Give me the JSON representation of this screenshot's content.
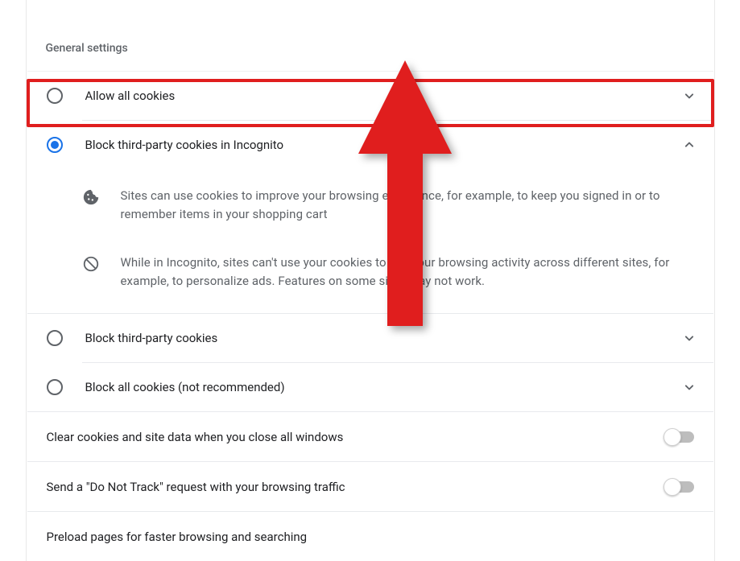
{
  "sectionTitle": "General settings",
  "options": {
    "allowAll": {
      "label": "Allow all cookies"
    },
    "blockIncognito": {
      "label": "Block third-party cookies in Incognito",
      "details": {
        "cookie": "Sites can use cookies to improve your browsing experience, for example, to keep you signed in or to remember items in your shopping cart",
        "block": "While in Incognito, sites can't use your cookies to see your browsing activity across different sites, for example, to personalize ads. Features on some sites may not work."
      }
    },
    "blockThird": {
      "label": "Block third-party cookies"
    },
    "blockAll": {
      "label": "Block all cookies (not recommended)"
    }
  },
  "toggles": {
    "clearOnClose": {
      "label": "Clear cookies and site data when you close all windows"
    },
    "doNotTrack": {
      "label": "Send a \"Do Not Track\" request with your browsing traffic"
    },
    "preload": {
      "label": "Preload pages for faster browsing and searching"
    }
  },
  "colors": {
    "highlight": "#e01e1e",
    "accent": "#1a73e8"
  }
}
